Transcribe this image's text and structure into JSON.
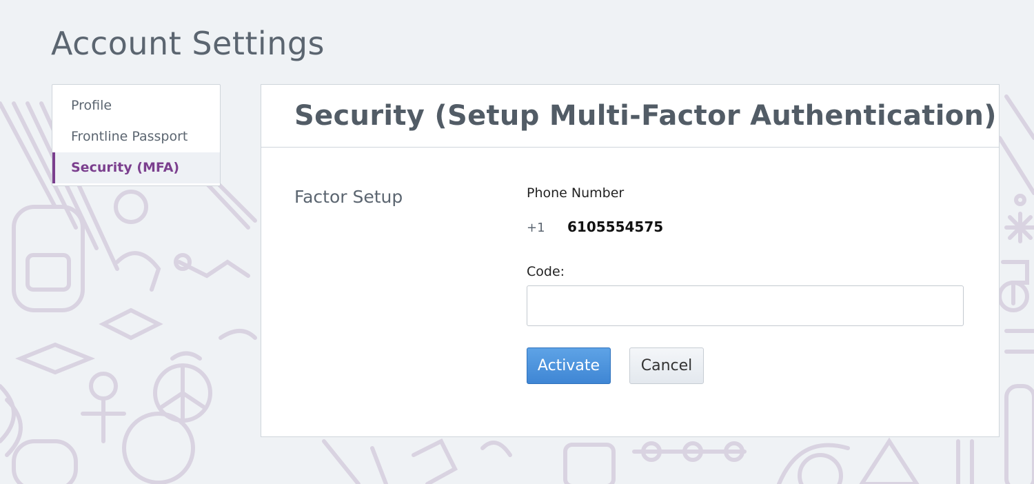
{
  "page": {
    "title": "Account Settings"
  },
  "sidebar": {
    "items": [
      {
        "label": "Profile",
        "active": false
      },
      {
        "label": "Frontline Passport",
        "active": false
      },
      {
        "label": "Security (MFA)",
        "active": true
      }
    ]
  },
  "panel": {
    "title": "Security (Setup Multi-Factor Authentication)",
    "section_label": "Factor Setup",
    "phone_label": "Phone Number",
    "country_code": "+1",
    "phone_number": "6105554575",
    "code_label": "Code:",
    "code_value": "",
    "activate_label": "Activate",
    "cancel_label": "Cancel"
  },
  "colors": {
    "background": "#eff2f5",
    "accent_purple": "#7b3f8e",
    "primary_blue": "#3f86d4",
    "doodle": "#d8d2e0"
  }
}
